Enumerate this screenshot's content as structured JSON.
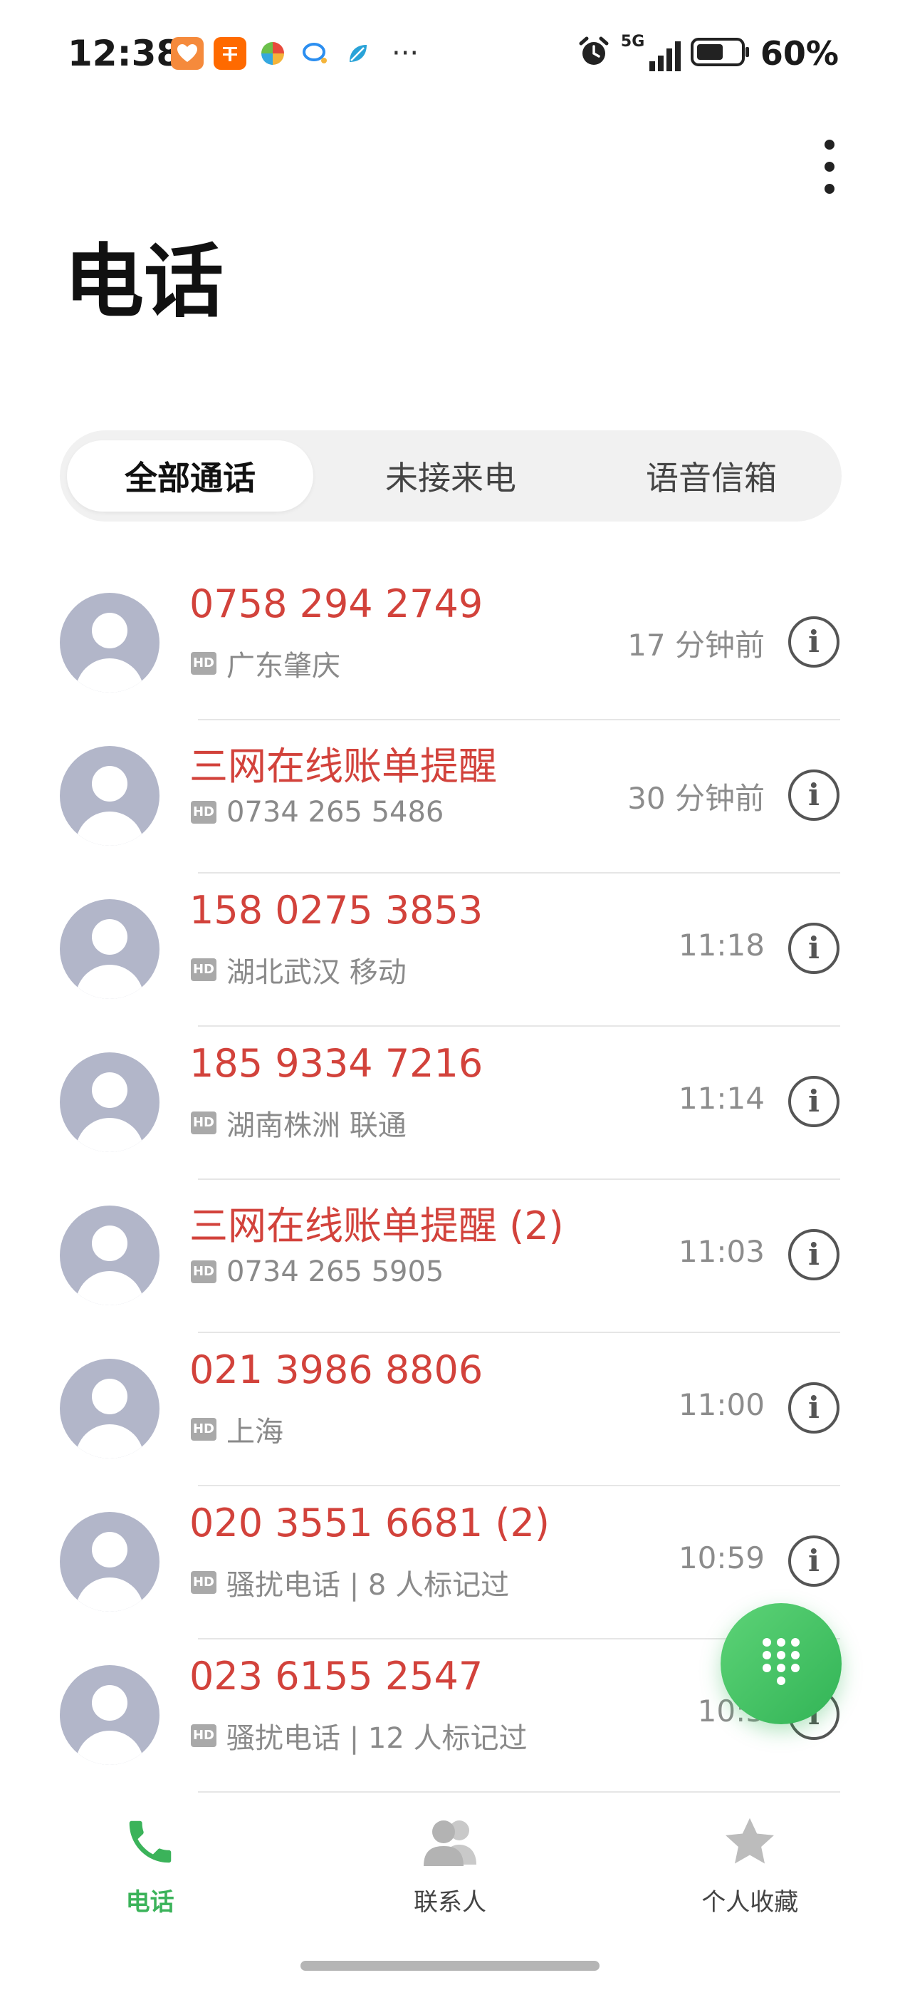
{
  "status_bar": {
    "time": "12:38",
    "battery_text": "60%",
    "network": "5G",
    "notification_icons": [
      "health-icon",
      "taobao-icon",
      "pinwheel-icon",
      "chat-icon",
      "leaf-icon"
    ],
    "overflow": "···"
  },
  "header": {
    "title": "电话"
  },
  "tabs": [
    {
      "label": "全部通话",
      "active": true
    },
    {
      "label": "未接来电",
      "active": false
    },
    {
      "label": "语音信箱",
      "active": false
    }
  ],
  "calls": [
    {
      "name": "0758 294 2749",
      "hd": "HD",
      "sub": "广东肇庆",
      "time": "17 分钟前"
    },
    {
      "name": "三网在线账单提醒",
      "hd": "HD",
      "sub": "0734 265 5486",
      "time": "30 分钟前"
    },
    {
      "name": "158 0275 3853",
      "hd": "HD",
      "sub": "湖北武汉 移动",
      "time": "11:18"
    },
    {
      "name": "185 9334 7216",
      "hd": "HD",
      "sub": "湖南株洲 联通",
      "time": "11:14"
    },
    {
      "name": "三网在线账单提醒 (2)",
      "hd": "HD",
      "sub": "0734 265 5905",
      "time": "11:03"
    },
    {
      "name": "021 3986 8806",
      "hd": "HD",
      "sub": "上海",
      "time": "11:00"
    },
    {
      "name": "020 3551 6681 (2)",
      "hd": "HD",
      "sub": "骚扰电话 | 8 人标记过",
      "time": "10:59"
    },
    {
      "name": "023 6155 2547",
      "hd": "HD",
      "sub": "骚扰电话 | 12 人标记过",
      "time": "10:5"
    }
  ],
  "bottom_nav": [
    {
      "label": "电话",
      "icon": "phone-icon",
      "active": true
    },
    {
      "label": "联系人",
      "icon": "contacts-icon",
      "active": false
    },
    {
      "label": "个人收藏",
      "icon": "star-icon",
      "active": false
    }
  ],
  "colors": {
    "accent_green": "#3bb35a",
    "missed_red": "#d2423b",
    "avatar": "#b2b6c9"
  }
}
